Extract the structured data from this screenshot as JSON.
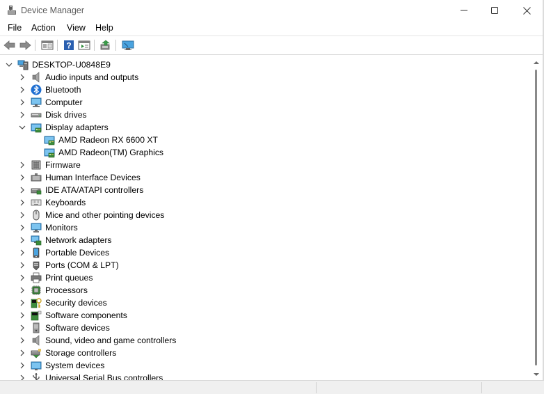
{
  "window": {
    "title": "Device Manager"
  },
  "menu": [
    {
      "label": "File"
    },
    {
      "label": "Action"
    },
    {
      "label": "View"
    },
    {
      "label": "Help"
    }
  ],
  "toolbar": [
    {
      "name": "back-button",
      "icon": "arrow-left-icon"
    },
    {
      "name": "forward-button",
      "icon": "arrow-right-icon"
    },
    {
      "name": "properties-button",
      "icon": "properties-icon"
    },
    {
      "name": "help-button",
      "icon": "help-icon"
    },
    {
      "name": "show-hide-console-tree-button",
      "icon": "console-tree-icon"
    },
    {
      "name": "update-driver-button",
      "icon": "update-driver-icon"
    },
    {
      "name": "scan-hardware-button",
      "icon": "monitor-scan-icon"
    }
  ],
  "tree": {
    "root": {
      "label": "DESKTOP-U0848E9",
      "expanded": true
    },
    "categories": [
      {
        "label": "Audio inputs and outputs",
        "icon": "speaker-icon",
        "expanded": false
      },
      {
        "label": "Bluetooth",
        "icon": "bluetooth-icon",
        "expanded": false
      },
      {
        "label": "Computer",
        "icon": "computer-icon",
        "expanded": false
      },
      {
        "label": "Disk drives",
        "icon": "disk-drive-icon",
        "expanded": false
      },
      {
        "label": "Display adapters",
        "icon": "display-adapter-icon",
        "expanded": true,
        "children": [
          {
            "label": "AMD Radeon RX 6600 XT",
            "icon": "display-adapter-icon"
          },
          {
            "label": "AMD Radeon(TM) Graphics",
            "icon": "display-adapter-icon"
          }
        ]
      },
      {
        "label": "Firmware",
        "icon": "firmware-icon",
        "expanded": false
      },
      {
        "label": "Human Interface Devices",
        "icon": "hid-icon",
        "expanded": false
      },
      {
        "label": "IDE ATA/ATAPI controllers",
        "icon": "ide-controller-icon",
        "expanded": false
      },
      {
        "label": "Keyboards",
        "icon": "keyboard-icon",
        "expanded": false
      },
      {
        "label": "Mice and other pointing devices",
        "icon": "mouse-icon",
        "expanded": false
      },
      {
        "label": "Monitors",
        "icon": "monitor-icon",
        "expanded": false
      },
      {
        "label": "Network adapters",
        "icon": "network-adapter-icon",
        "expanded": false
      },
      {
        "label": "Portable Devices",
        "icon": "portable-device-icon",
        "expanded": false
      },
      {
        "label": "Ports (COM & LPT)",
        "icon": "port-icon",
        "expanded": false
      },
      {
        "label": "Print queues",
        "icon": "printer-icon",
        "expanded": false
      },
      {
        "label": "Processors",
        "icon": "processor-icon",
        "expanded": false
      },
      {
        "label": "Security devices",
        "icon": "security-device-icon",
        "expanded": false
      },
      {
        "label": "Software components",
        "icon": "software-component-icon",
        "expanded": false
      },
      {
        "label": "Software devices",
        "icon": "software-device-icon",
        "expanded": false
      },
      {
        "label": "Sound, video and game controllers",
        "icon": "sound-controller-icon",
        "expanded": false
      },
      {
        "label": "Storage controllers",
        "icon": "storage-controller-icon",
        "expanded": false
      },
      {
        "label": "System devices",
        "icon": "system-device-icon",
        "expanded": false
      },
      {
        "label": "Universal Serial Bus controllers",
        "icon": "usb-icon",
        "expanded": false
      }
    ]
  },
  "colors": {
    "accent": "#0078d4",
    "expander": "#404040",
    "border": "#d9d9d9"
  }
}
